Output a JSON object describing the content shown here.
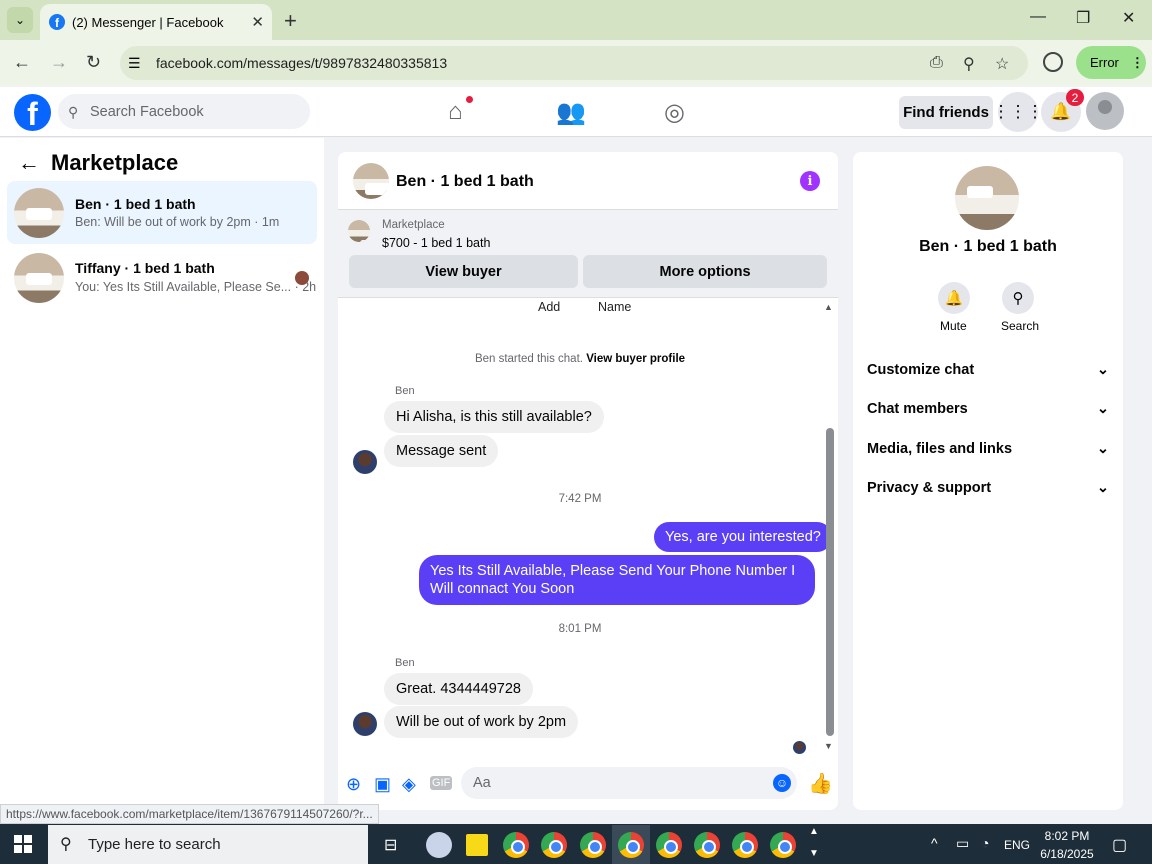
{
  "browser": {
    "tab_title": "(2) Messenger | Facebook",
    "url": "facebook.com/messages/t/9897832480335813",
    "error_label": "Error",
    "status_url": "https://www.facebook.com/marketplace/item/1367679114507260/?r..."
  },
  "fb": {
    "search_placeholder": "Search Facebook",
    "find_friends": "Find friends",
    "notification_count": "2"
  },
  "left_panel": {
    "title": "Marketplace",
    "conversations": [
      {
        "title": "Ben · 1 bed 1 bath",
        "snippet": "Ben: Will be out of work by 2pm · 1m",
        "active": true
      },
      {
        "title": "Tiffany · 1 bed 1 bath",
        "snippet": "You: Yes Its Still Available, Please Se... · 2h",
        "active": false
      }
    ]
  },
  "chat": {
    "title": "Ben · 1 bed 1 bath",
    "marketplace_label": "Marketplace",
    "listing": "$700 - 1 bed 1 bath",
    "view_buyer": "View buyer",
    "more_options": "More options",
    "partial_labels": [
      "Add",
      "Name"
    ],
    "started_text": "Ben started this chat.",
    "view_profile": "View buyer profile",
    "sender_name": "Ben",
    "messages_group1": [
      "Hi Alisha, is this still available?",
      "Message sent"
    ],
    "time1": "7:42 PM",
    "outgoing": [
      "Yes, are you interested?",
      "Yes Its Still Available, Please Send Your Phone Number I Will connact You Soon"
    ],
    "time2": "8:01 PM",
    "messages_group2": [
      "Great. 4344449728",
      "Will be out of work by 2pm"
    ],
    "input_placeholder": "Aa"
  },
  "right_panel": {
    "title": "Ben · 1 bed 1 bath",
    "actions": [
      "Mute",
      "Search"
    ],
    "sections": [
      "Customize chat",
      "Chat members",
      "Media, files and links",
      "Privacy & support"
    ]
  },
  "taskbar": {
    "search_placeholder": "Type here to search",
    "lang": "ENG",
    "time": "8:02 PM",
    "date": "6/18/2025"
  },
  "colors": {
    "fb_blue": "#0866ff",
    "outgoing_bubble": "#5b3ff6",
    "chrome_bg": "#d3e3c4"
  }
}
